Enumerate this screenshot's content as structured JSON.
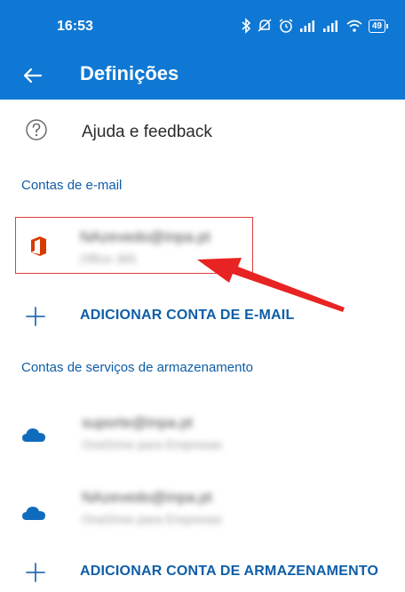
{
  "status_bar": {
    "time": "16:53",
    "battery": "49",
    "icons": [
      "bluetooth-icon",
      "mute-icon",
      "alarm-icon",
      "signal-icon",
      "signal-icon",
      "wifi-icon",
      "battery-icon"
    ]
  },
  "app_bar": {
    "title": "Definições",
    "back_icon": "arrow-left-icon"
  },
  "help": {
    "label": "Ajuda e feedback",
    "icon": "question-circle-icon"
  },
  "email_section": {
    "header": "Contas de e-mail",
    "account": {
      "address": "NAzevedo@inpa.pt",
      "type": "Office 365",
      "icon": "office-icon"
    },
    "add_label": "ADICIONAR CONTA DE E-MAIL"
  },
  "storage_section": {
    "header": "Contas de serviços de armazenamento",
    "accounts": [
      {
        "address": "suporte@inpa.pt",
        "type": "OneDrive para Empresas",
        "icon": "onedrive-cloud-icon"
      },
      {
        "address": "NAzevedo@inpa.pt",
        "type": "OneDrive para Empresas",
        "icon": "onedrive-cloud-icon"
      }
    ],
    "add_label": "ADICIONAR CONTA DE ARMAZENAMENTO"
  },
  "colors": {
    "accent": "#0f78d4",
    "link": "#0f5ea8",
    "highlight": "#e43d3d",
    "office": "#d83b01"
  }
}
